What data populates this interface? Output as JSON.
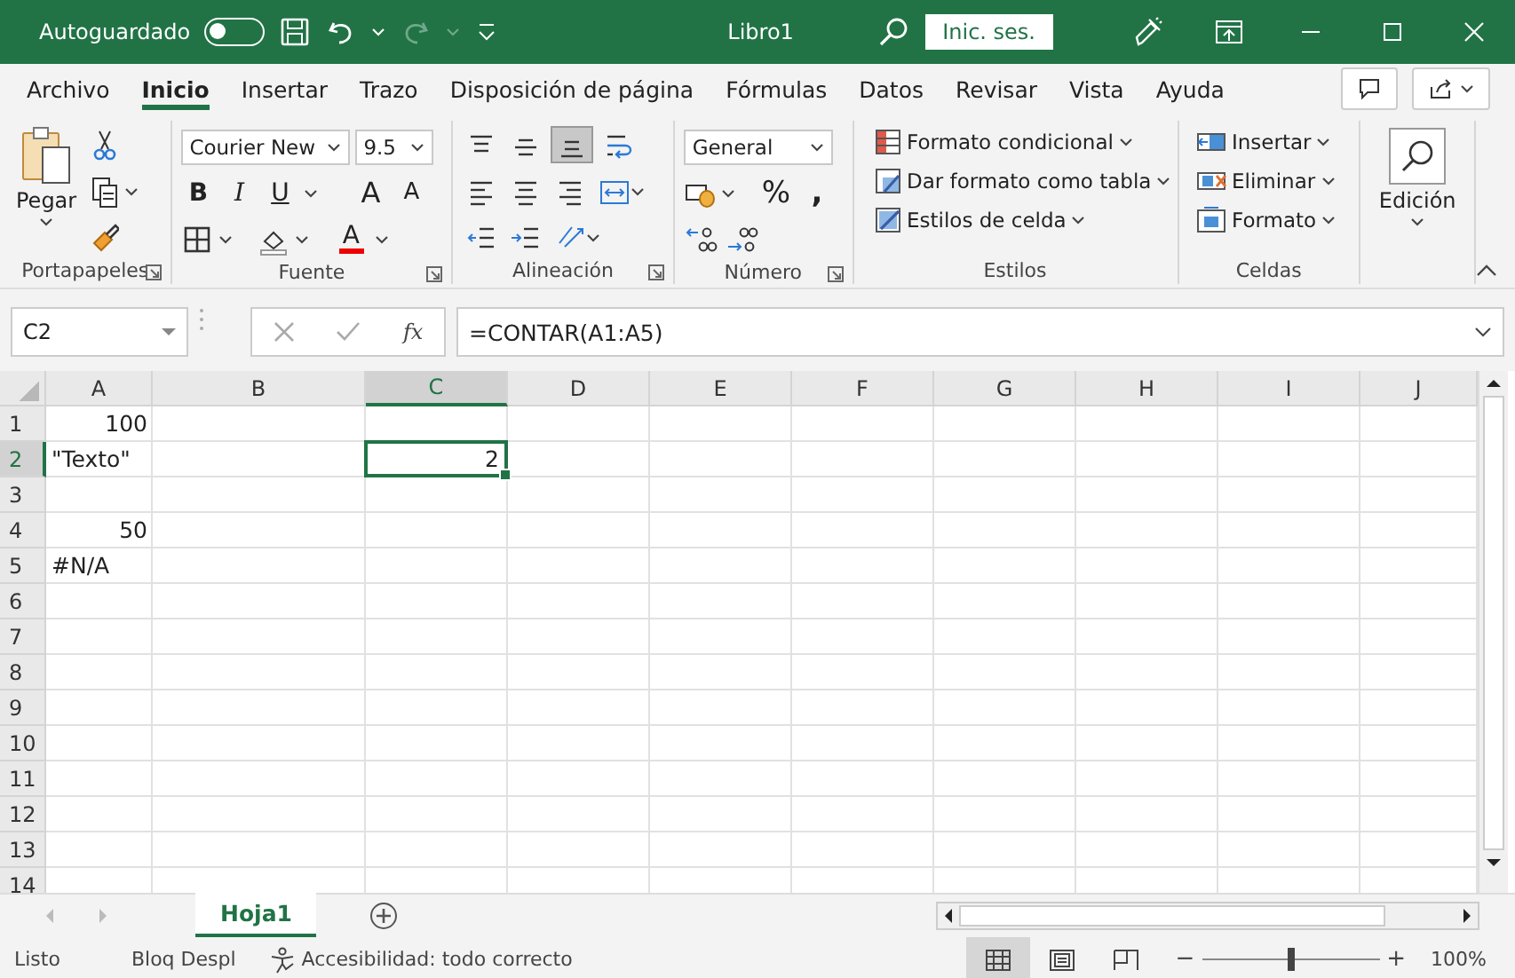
{
  "title_bar": {
    "autosave_label": "Autoguardado",
    "autosave_on": false,
    "title": "Libro1",
    "sign_in": "Inic. ses."
  },
  "menu_tabs": [
    {
      "label": "Archivo",
      "selected": false
    },
    {
      "label": "Inicio",
      "selected": true
    },
    {
      "label": "Insertar",
      "selected": false
    },
    {
      "label": "Trazo",
      "selected": false
    },
    {
      "label": "Disposición de página",
      "selected": false
    },
    {
      "label": "Fórmulas",
      "selected": false
    },
    {
      "label": "Datos",
      "selected": false
    },
    {
      "label": "Revisar",
      "selected": false
    },
    {
      "label": "Vista",
      "selected": false
    },
    {
      "label": "Ayuda",
      "selected": false
    }
  ],
  "ribbon": {
    "clipboard": {
      "label": "Portapapeles",
      "paste": "Pegar"
    },
    "font": {
      "label": "Fuente",
      "font_name": "Courier New",
      "font_size": "9.5",
      "bold": "B",
      "italic": "I",
      "underline": "U",
      "grow": "A",
      "shrink": "A",
      "font_color": "A"
    },
    "alignment": {
      "label": "Alineación",
      "buttons": [
        {
          "kind": "top",
          "selected": false
        },
        {
          "kind": "middle",
          "selected": false
        },
        {
          "kind": "bottom",
          "selected": true
        },
        {
          "kind": "wrap",
          "selected": false
        },
        {
          "kind": "left",
          "selected": false
        },
        {
          "kind": "center",
          "selected": false
        },
        {
          "kind": "right",
          "selected": false
        },
        {
          "kind": "merge",
          "selected": false
        },
        {
          "kind": "outdent",
          "selected": false
        },
        {
          "kind": "indent",
          "selected": false
        },
        {
          "kind": "orientation",
          "selected": false
        }
      ]
    },
    "number": {
      "label": "Número",
      "format": "General",
      "percent": "%",
      "comma": ","
    },
    "styles": {
      "label": "Estilos",
      "items": [
        {
          "kind": "conditional",
          "label": "Formato condicional"
        },
        {
          "kind": "table",
          "label": "Dar formato como tabla"
        },
        {
          "kind": "cell",
          "label": "Estilos de celda"
        }
      ]
    },
    "cells": {
      "label": "Celdas",
      "items": [
        {
          "kind": "insert",
          "label": "Insertar"
        },
        {
          "kind": "delete",
          "label": "Eliminar"
        },
        {
          "kind": "format",
          "label": "Formato"
        }
      ]
    },
    "editing": {
      "label": "Edición"
    }
  },
  "formula_bar": {
    "name_box": "C2",
    "fx": "fx",
    "formula": "=CONTAR(A1:A5)"
  },
  "sheet": {
    "columns": [
      {
        "label": "A",
        "selected": false
      },
      {
        "label": "B",
        "selected": false
      },
      {
        "label": "C",
        "selected": true
      },
      {
        "label": "D",
        "selected": false
      },
      {
        "label": "E",
        "selected": false
      },
      {
        "label": "F",
        "selected": false
      },
      {
        "label": "G",
        "selected": false
      },
      {
        "label": "H",
        "selected": false
      },
      {
        "label": "I",
        "selected": false
      },
      {
        "label": "J",
        "selected": false
      }
    ],
    "rows": [
      {
        "label": "1",
        "selected": false,
        "cells": [
          {
            "value": "100",
            "kind": "number",
            "selected": false
          }
        ]
      },
      {
        "label": "2",
        "selected": true,
        "cells": [
          {
            "value": "\"Texto\"",
            "kind": "text",
            "selected": false
          },
          null,
          {
            "value": "2",
            "kind": "number",
            "selected": true
          }
        ]
      },
      {
        "label": "3",
        "selected": false
      },
      {
        "label": "4",
        "selected": false,
        "cells": [
          {
            "value": "50",
            "kind": "number",
            "selected": false
          }
        ]
      },
      {
        "label": "5",
        "selected": false,
        "cells": [
          {
            "value": "#N/A",
            "kind": "error",
            "selected": false
          }
        ]
      },
      {
        "label": "6",
        "selected": false
      },
      {
        "label": "7",
        "selected": false
      },
      {
        "label": "8",
        "selected": false
      },
      {
        "label": "9",
        "selected": false
      },
      {
        "label": "10",
        "selected": false
      },
      {
        "label": "11",
        "selected": false
      },
      {
        "label": "12",
        "selected": false
      },
      {
        "label": "13",
        "selected": false
      },
      {
        "label": "14",
        "selected": false
      }
    ]
  },
  "sheet_tabs": [
    {
      "label": "Hoja1",
      "selected": true
    }
  ],
  "status_bar": {
    "ready": "Listo",
    "scroll_lock": "Bloq Despl",
    "accessibility": "Accesibilidad: todo correcto",
    "views": [
      {
        "kind": "normal",
        "selected": true
      },
      {
        "kind": "page-layout",
        "selected": false
      },
      {
        "kind": "page-break",
        "selected": false
      }
    ],
    "zoom_out": "−",
    "zoom_in": "+",
    "zoom": {
      "level": 0.5
    },
    "zoom_reading": "100%"
  }
}
